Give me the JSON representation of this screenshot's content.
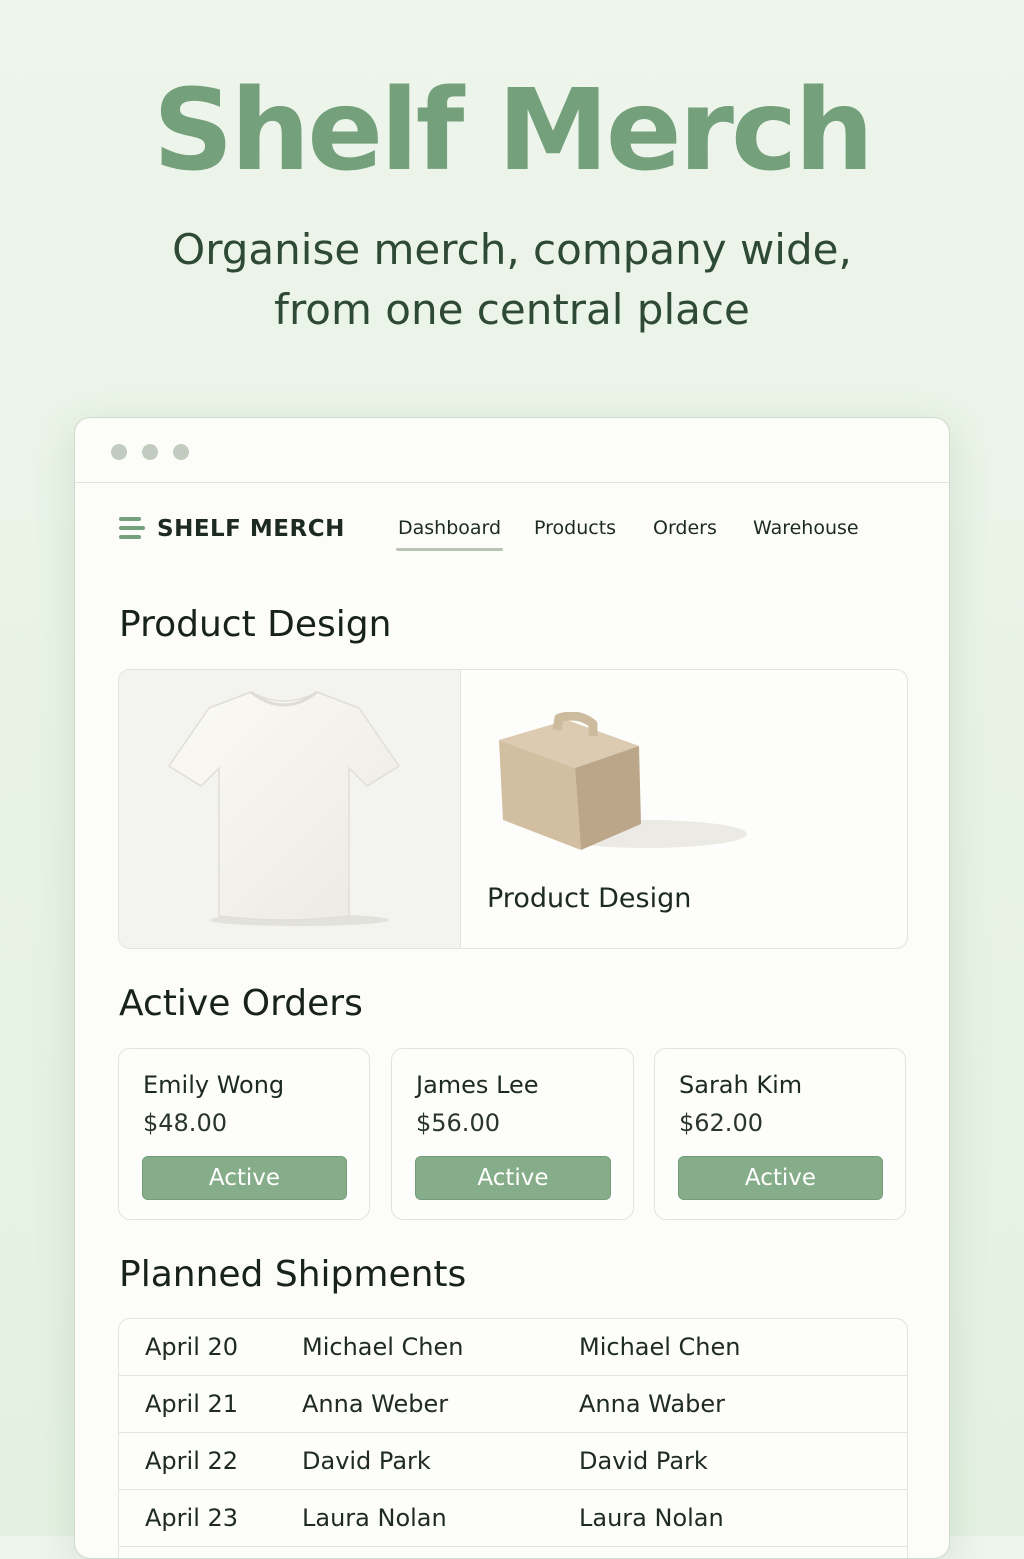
{
  "hero": {
    "title": "Shelf Merch",
    "subtitle_line1": "Organise merch, company wide,",
    "subtitle_line2": "from one central place"
  },
  "app": {
    "brand": "SHELF MERCH",
    "brand_icon": "stacked-lines-logo",
    "nav": [
      {
        "label": "Dashboard",
        "active": true
      },
      {
        "label": "Products",
        "active": false
      },
      {
        "label": "Orders",
        "active": false
      },
      {
        "label": "Warehouse",
        "active": false
      }
    ]
  },
  "product_design": {
    "title": "Product Design",
    "card_label": "Product Design",
    "images": [
      "t-shirt",
      "packaging-box"
    ]
  },
  "active_orders": {
    "title": "Active Orders",
    "orders": [
      {
        "name": "Emily Wong",
        "amount": "$48.00",
        "status": "Active"
      },
      {
        "name": "James Lee",
        "amount": "$56.00",
        "status": "Active"
      },
      {
        "name": "Sarah Kim",
        "amount": "$62.00",
        "status": "Active"
      }
    ]
  },
  "planned_shipments": {
    "title": "Planned Shipments",
    "rows": [
      {
        "date": "April 20",
        "name": "Michael Chen",
        "contact": "Michael Chen"
      },
      {
        "date": "April 21",
        "name": "Anna Weber",
        "contact": "Anna Waber"
      },
      {
        "date": "April 22",
        "name": "David Park",
        "contact": "David Park"
      },
      {
        "date": "April 23",
        "name": "Laura Nolan",
        "contact": "Laura Nolan"
      }
    ]
  },
  "colors": {
    "accent": "#74a07b",
    "button": "#86ad89",
    "background": "#e8f3e6",
    "window": "#fcfcf9"
  }
}
